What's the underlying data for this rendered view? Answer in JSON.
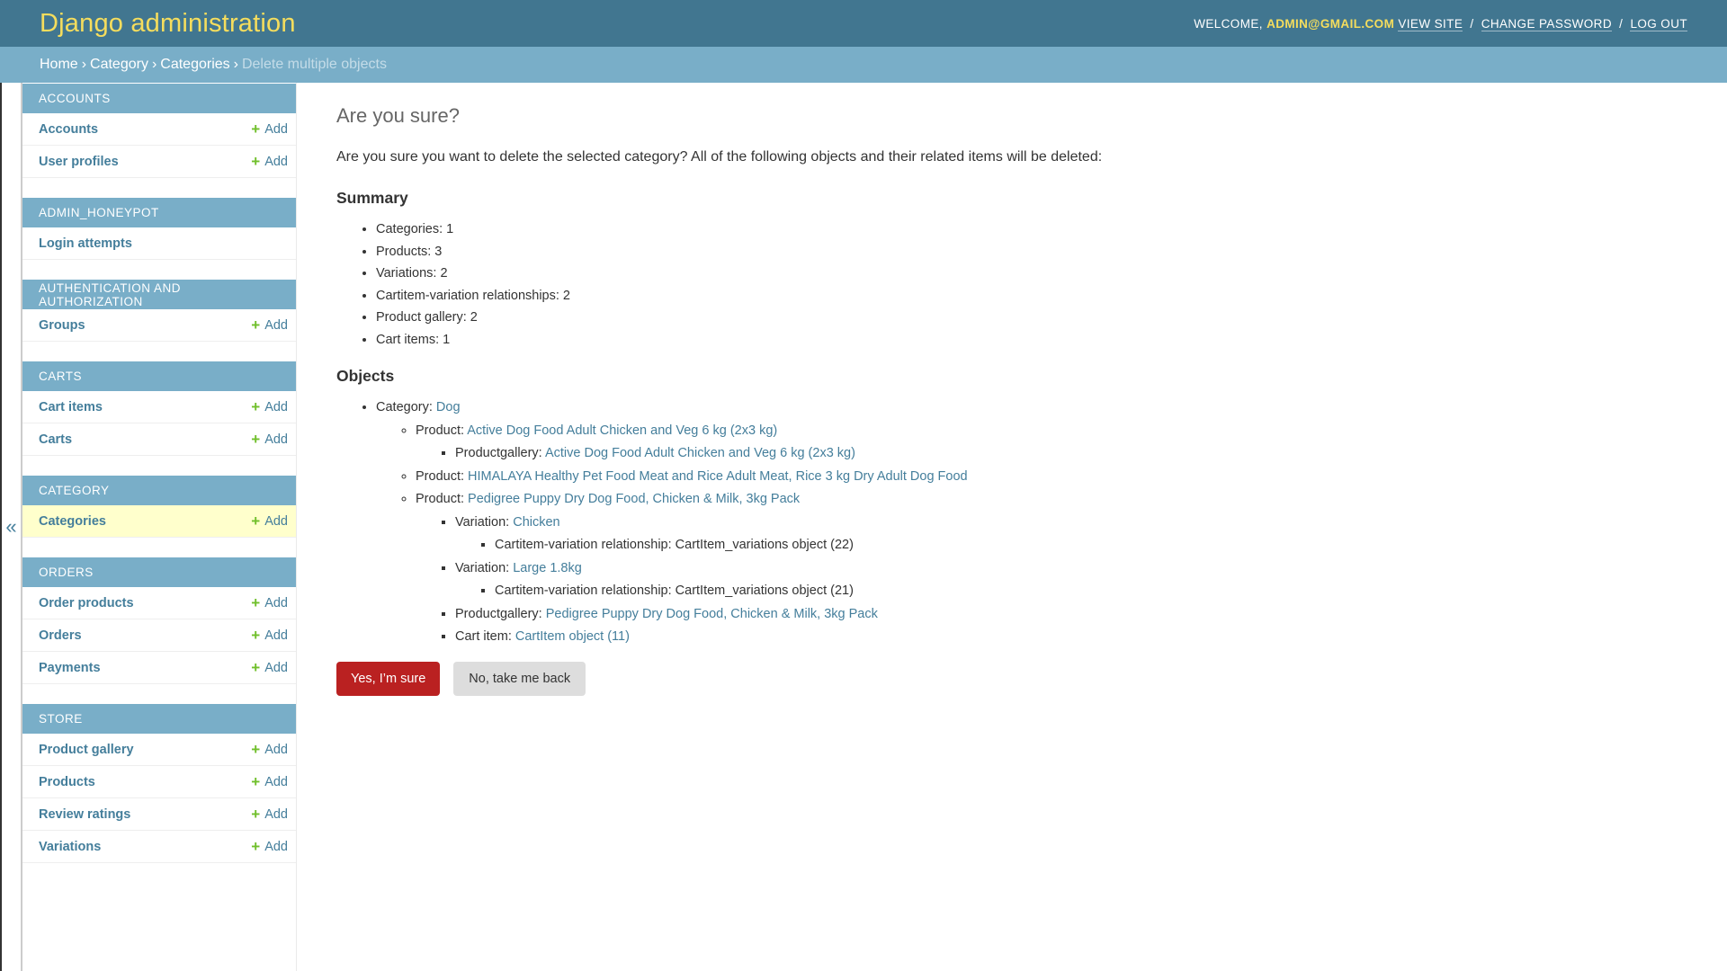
{
  "header": {
    "branding": "Django administration",
    "welcome": "WELCOME,",
    "username": "ADMIN@GMAIL.COM",
    "view_site": "VIEW SITE",
    "change_password": "CHANGE PASSWORD",
    "log_out": "LOG OUT",
    "separator": "/"
  },
  "breadcrumbs": {
    "home": "Home",
    "app": "Category",
    "model": "Categories",
    "current": "Delete multiple objects",
    "separator": "›"
  },
  "sidebar": {
    "toggle": "«",
    "add_label": "Add",
    "modules": [
      {
        "caption": "ACCOUNTS",
        "models": [
          "Accounts",
          "User profiles"
        ]
      },
      {
        "caption": "ADMIN_HONEYPOT",
        "models": [
          "Login attempts"
        ]
      },
      {
        "caption": "AUTHENTICATION AND AUTHORIZATION",
        "models": [
          "Groups"
        ]
      },
      {
        "caption": "CARTS",
        "models": [
          "Cart items",
          "Carts"
        ]
      },
      {
        "caption": "CATEGORY",
        "models": [
          "Categories"
        ]
      },
      {
        "caption": "ORDERS",
        "models": [
          "Order products",
          "Orders",
          "Payments"
        ]
      },
      {
        "caption": "STORE",
        "models": [
          "Product gallery",
          "Products",
          "Review ratings",
          "Variations"
        ]
      }
    ]
  },
  "content": {
    "title": "Are you sure?",
    "intro": "Are you sure you want to delete the selected category? All of the following objects and their related items will be deleted:",
    "summary_heading": "Summary",
    "summary": [
      "Categories: 1",
      "Products: 3",
      "Variations: 2",
      "Cartitem-variation relationships: 2",
      "Product gallery: 2",
      "Cart items: 1"
    ],
    "objects_heading": "Objects",
    "objects": {
      "category_label": "Category:",
      "category_value": "Dog",
      "product1_label": "Product:",
      "product1_value": "Active Dog Food Adult Chicken and Veg 6 kg (2x3 kg)",
      "gallery1_label": "Productgallery:",
      "gallery1_value": "Active Dog Food Adult Chicken and Veg 6 kg (2x3 kg)",
      "product2_label": "Product:",
      "product2_value": "HIMALAYA Healthy Pet Food Meat and Rice Adult Meat, Rice 3 kg Dry Adult Dog Food",
      "product3_label": "Product:",
      "product3_value": "Pedigree Puppy Dry Dog Food, Chicken & Milk, 3kg Pack",
      "variation1_label": "Variation:",
      "variation1_value": "Chicken",
      "rel1": "Cartitem-variation relationship: CartItem_variations object (22)",
      "variation2_label": "Variation:",
      "variation2_value": "Large 1.8kg",
      "rel2": "Cartitem-variation relationship: CartItem_variations object (21)",
      "gallery3_label": "Productgallery:",
      "gallery3_value": "Pedigree Puppy Dry Dog Food, Chicken & Milk, 3kg Pack",
      "cartitem_label": "Cart item:",
      "cartitem_value": "CartItem object (11)"
    },
    "confirm_button": "Yes, I’m sure",
    "cancel_button": "No, take me back"
  }
}
